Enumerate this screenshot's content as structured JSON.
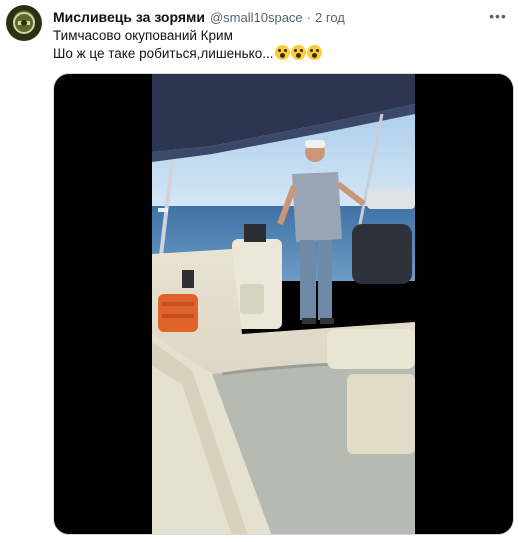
{
  "tweet": {
    "author_name": "Мисливець за зорями",
    "author_handle": "@small10space",
    "separator": "·",
    "time": "2 год",
    "more_label": "•••",
    "text_line1": "Тимчасово окупований Крим",
    "text_line2": "Шо ж це таке робиться,лишенько...",
    "emoji": "face-screaming-in-fear-emoji",
    "emoji_count": 3
  },
  "media": {
    "type": "video",
    "subject": "boat scene video frame"
  },
  "colors": {
    "text_primary": "#0f1419",
    "text_secondary": "#536471",
    "media_bg": "#000000",
    "border": "#cfd9de"
  }
}
